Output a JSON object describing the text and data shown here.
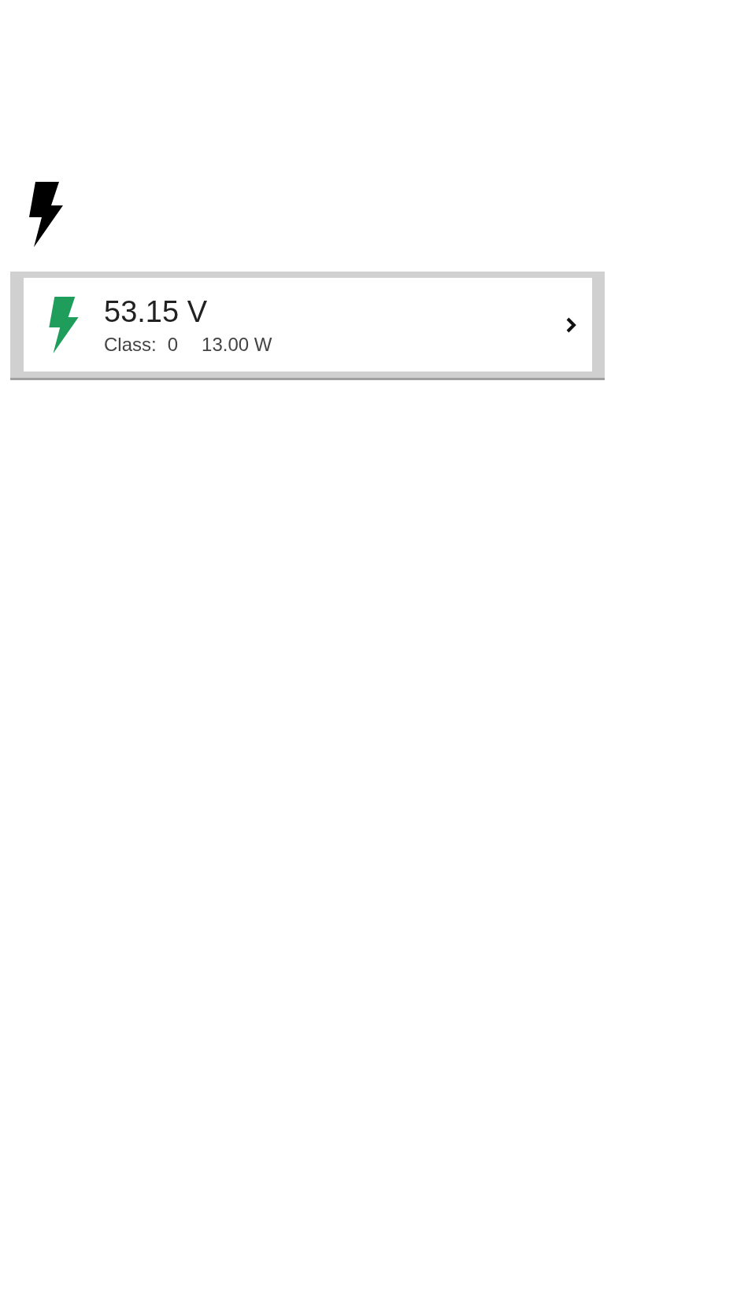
{
  "poe_card": {
    "voltage": "53.15 V",
    "class_label": "Class:",
    "class_value": "0",
    "power": "13.00 W"
  }
}
